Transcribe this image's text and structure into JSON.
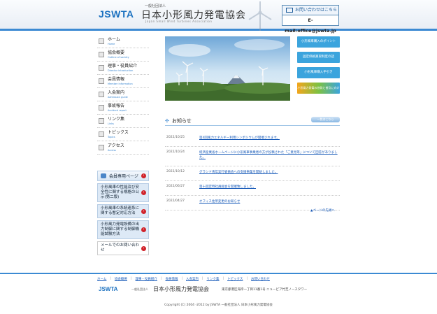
{
  "header": {
    "logo": "JSWTA",
    "org_sub": "一般社団法人",
    "org_name": "日本小形風力発電協会",
    "org_en": "Japan Small Wind Turbines Association",
    "contact_label": "お問い合わせはこちら",
    "contact_email": "E-mail:office@jswta.jp"
  },
  "nav": [
    {
      "jp": "ホーム",
      "en": "Home",
      "icon": "home-icon"
    },
    {
      "jp": "協会概要",
      "en": "Outline of society",
      "icon": "building-icon"
    },
    {
      "jp": "理事・役員紹介",
      "en": "Director introduction",
      "icon": "people-icon"
    },
    {
      "jp": "会員情報",
      "en": "Member information",
      "icon": "member-icon"
    },
    {
      "jp": "入会案内",
      "en": "Admission guide",
      "icon": "document-icon"
    },
    {
      "jp": "事故報告",
      "en": "Accident report",
      "icon": "report-icon"
    },
    {
      "jp": "リンク集",
      "en": "Links",
      "icon": "link-icon"
    },
    {
      "jp": "トピックス",
      "en": "Topics",
      "icon": "topics-icon"
    },
    {
      "jp": "アクセス",
      "en": "Access",
      "icon": "map-icon"
    }
  ],
  "member_page": "会員専用ページ",
  "member_links": [
    "小形風車の性能及び安全性に関する規格の公示(第二版)",
    "小形風車の系統連系に関する暫定対応方法",
    "小形風力発電設備の出力制御に関する制御機能試験方法"
  ],
  "member_mail": "メールでのお問い合わせ",
  "side_banners": [
    "小形風車購入のポイント",
    "固定価格買取制度の話",
    "小形風車購入手引き",
    "小形風力発電の啓発と普及に向けて"
  ],
  "news": {
    "title": "お知らせ",
    "more": "一覧はこちら",
    "items": [
      {
        "date": "2022/10/25",
        "text": "第4回風力エネルギー利用シンポジウムが開催されます。"
      },
      {
        "date": "2022/10/24",
        "text": "経済産業省ホームページに小形風車事業者の方が投稿された「ご意見等」について回答がありました。"
      },
      {
        "date": "2022/10/12",
        "text": "グランド青年実行委員会への支援事業を開始しました。"
      },
      {
        "date": "2022/06/27",
        "text": "第十回定時社員総会を開催致しました。"
      },
      {
        "date": "2022/04/27",
        "text": "オフィス住所変更のお知らせ"
      }
    ]
  },
  "page_top": "▲ページの先頭へ",
  "footer": {
    "links": [
      "ホーム",
      "協会概要",
      "理事・役員紹介",
      "会員情報",
      "入会案内",
      "リンク集",
      "トピックス",
      "お問い合わせ"
    ],
    "logo": "JSWTA",
    "org_sub": "一般社団法人",
    "org_name": "日本小形風力発電協会",
    "address": "東京都港区海岸一丁目11番1号 ニューピア竹芝ノースタワー",
    "copyright": "Copyright (C) 2004 -2012 by JSWTA 一般社団法人 日本小形風力発電協会"
  }
}
